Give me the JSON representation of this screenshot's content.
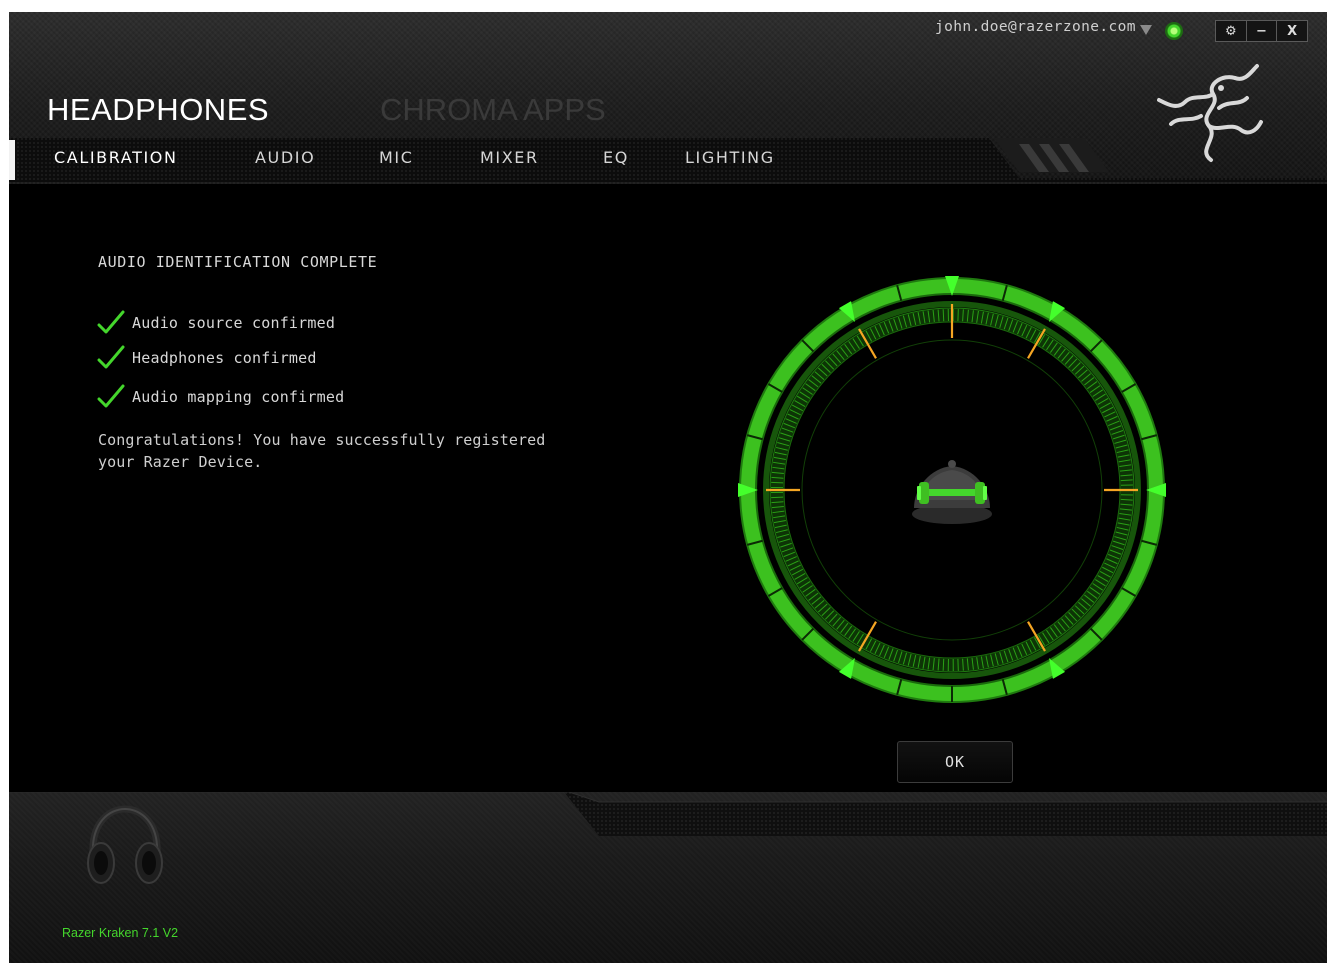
{
  "app": {
    "title": "HEADPHONES",
    "secondary_title": "CHROMA APPS"
  },
  "account": {
    "email": "john.doe@razerzone.com",
    "dropdown_icon": "chevron-down-icon",
    "status_icon": "online-status-icon",
    "status_color": "#44d62c"
  },
  "window_controls": {
    "settings": "⚙",
    "minimize": "−",
    "close": "X"
  },
  "tabs": [
    {
      "label": "CALIBRATION",
      "active": true
    },
    {
      "label": "AUDIO",
      "active": false
    },
    {
      "label": "MIC",
      "active": false
    },
    {
      "label": "MIXER",
      "active": false
    },
    {
      "label": "EQ",
      "active": false
    },
    {
      "label": "LIGHTING",
      "active": false
    }
  ],
  "calibration": {
    "title": "AUDIO IDENTIFICATION COMPLETE",
    "checks": [
      {
        "label": "Audio source confirmed",
        "icon": "checkmark-icon"
      },
      {
        "label": "Headphones confirmed",
        "icon": "checkmark-icon"
      },
      {
        "label": "Audio mapping confirmed",
        "icon": "checkmark-icon"
      }
    ],
    "message": "Congratulations! You have successfully registered your Razer Device.",
    "ok_label": "OK"
  },
  "footer": {
    "device_name": "Razer Kraken 7.1 V2",
    "device_icon": "headset-icon"
  },
  "colors": {
    "accent": "#44d62c",
    "marker": "#f5a623",
    "background": "#000000"
  }
}
